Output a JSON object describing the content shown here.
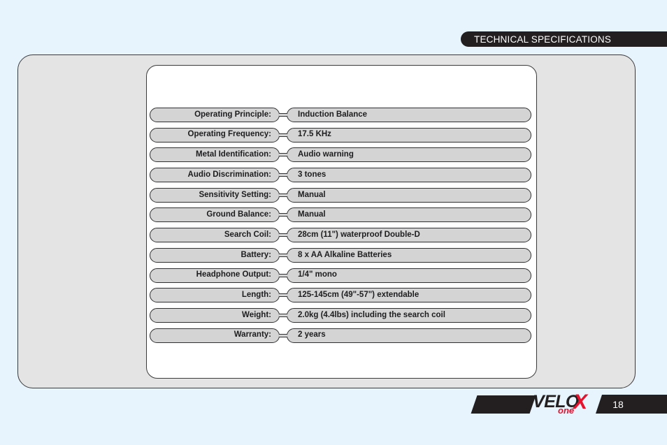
{
  "header": {
    "title": "TECHNICAL SPECIFICATIONS"
  },
  "specs": {
    "rows": [
      {
        "label": "Operating Principle:",
        "value": "Induction Balance"
      },
      {
        "label": "Operating Frequency:",
        "value": "17.5 KHz"
      },
      {
        "label": "Metal Identification:",
        "value": "Audio warning"
      },
      {
        "label": "Audio Discrimination:",
        "value": "3 tones"
      },
      {
        "label": "Sensitivity Setting:",
        "value": "Manual"
      },
      {
        "label": "Ground Balance:",
        "value": "Manual"
      },
      {
        "label": "Search Coil:",
        "value": "28cm (11\") waterproof Double-D"
      },
      {
        "label": "Battery:",
        "value": "8 x AA Alkaline Batteries"
      },
      {
        "label": "Headphone Output:",
        "value": "1/4\" mono"
      },
      {
        "label": "Length:",
        "value": "125-145cm (49\"-57\") extendable"
      },
      {
        "label": "Weight:",
        "value": "2.0kg (4.4lbs) including the search coil"
      },
      {
        "label": "Warranty:",
        "value": "2 years"
      }
    ]
  },
  "footer": {
    "brand_main": "VELO",
    "brand_x": "X",
    "brand_sub": "one",
    "page_number": "18"
  },
  "colors": {
    "page_background": "#e8f4fd",
    "dark": "#231f20",
    "pill_fill": "#d4d4d4",
    "card_fill": "#e4e4e4",
    "accent_red": "#e8112d"
  }
}
